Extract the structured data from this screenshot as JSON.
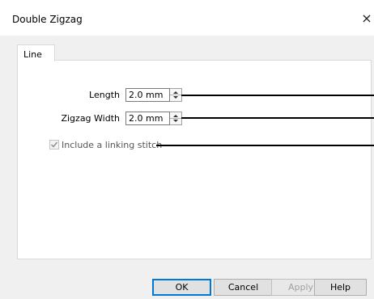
{
  "window": {
    "title": "Double Zigzag",
    "close_symbol": "×"
  },
  "tabs": [
    {
      "label": "Line"
    }
  ],
  "fields": {
    "length": {
      "label": "Length",
      "value": "2.0 mm"
    },
    "zigzag_width": {
      "label": "Zigzag Width",
      "value": "2.0 mm"
    }
  },
  "linking_stitch": {
    "label": "Include a linking stitch",
    "checked": true,
    "enabled": false
  },
  "buttons": {
    "ok": "OK",
    "cancel": "Cancel",
    "apply": "Apply",
    "help": "Help"
  },
  "colors": {
    "accent": "#0078d7",
    "panel_border": "#d9d9d9",
    "dialog_bg": "#f0f0f0"
  }
}
